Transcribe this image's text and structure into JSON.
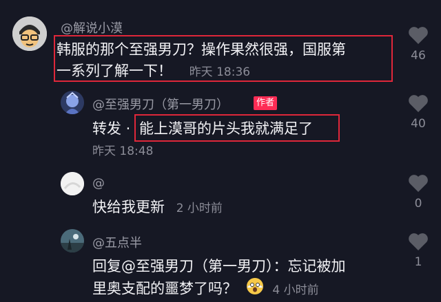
{
  "comments": [
    {
      "username": "@解说小漠",
      "text": "韩服的那个至强男刀？操作果然很强，国服第",
      "text_line2": "一系列了解一下！",
      "time": "昨天 18:36",
      "likes": "46"
    },
    {
      "username": "@至强男刀（第一男刀）",
      "author_badge": "作者",
      "prefix": "转发 ·",
      "text": "能上漠哥的片头我就满足了",
      "time": "昨天 18:48",
      "likes": "40"
    },
    {
      "username": "@",
      "text": "快给我更新",
      "time": "2 小时前",
      "likes": "0"
    },
    {
      "username": "@五点半",
      "text": "回复@至强男刀（第一男刀）：忘记被加",
      "text_line2": "里奥支配的噩梦了吗？",
      "emoji": "scared-face-emoji",
      "time": "4 小时前",
      "likes": "1"
    }
  ],
  "colors": {
    "background": "#161824",
    "highlight": "#e0273a",
    "badge": "#fe2c55"
  }
}
